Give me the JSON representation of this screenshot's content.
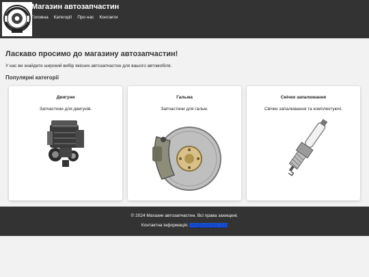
{
  "header": {
    "site_title": "Магазин автозапчастин",
    "logo_text": "AUTO PARTS & ACCESSORIES",
    "nav": [
      "Головна",
      "Категорії",
      "Про нас",
      "Контакти"
    ]
  },
  "main": {
    "welcome": "Ласкаво просимо до магазину автозапчастин!",
    "intro": "У нас ви знайдете широкий вибір якісних автозапчастин для вашого автомобіля.",
    "section_title": "Популярні категорії",
    "categories": [
      {
        "title": "Двигуни",
        "description": "Запчастини для двигунів.",
        "icon": "engine-image"
      },
      {
        "title": "Гальма",
        "description": "Запчастини для гальм.",
        "icon": "brake-image"
      },
      {
        "title": "Свічки запалювання",
        "description": "Свічки запалювання та комплектуючі.",
        "icon": "spark-plug-image"
      }
    ]
  },
  "footer": {
    "copyright": "© 2024 Магазин автозапчастин. Всі права захищені.",
    "contact_label": "Контактна інформація: ",
    "contact_email": "info@example.com"
  },
  "colors": {
    "header_bg": "#333333",
    "page_bg": "#f2f2f2",
    "card_bg": "#ffffff",
    "link": "#0b2fb0"
  }
}
